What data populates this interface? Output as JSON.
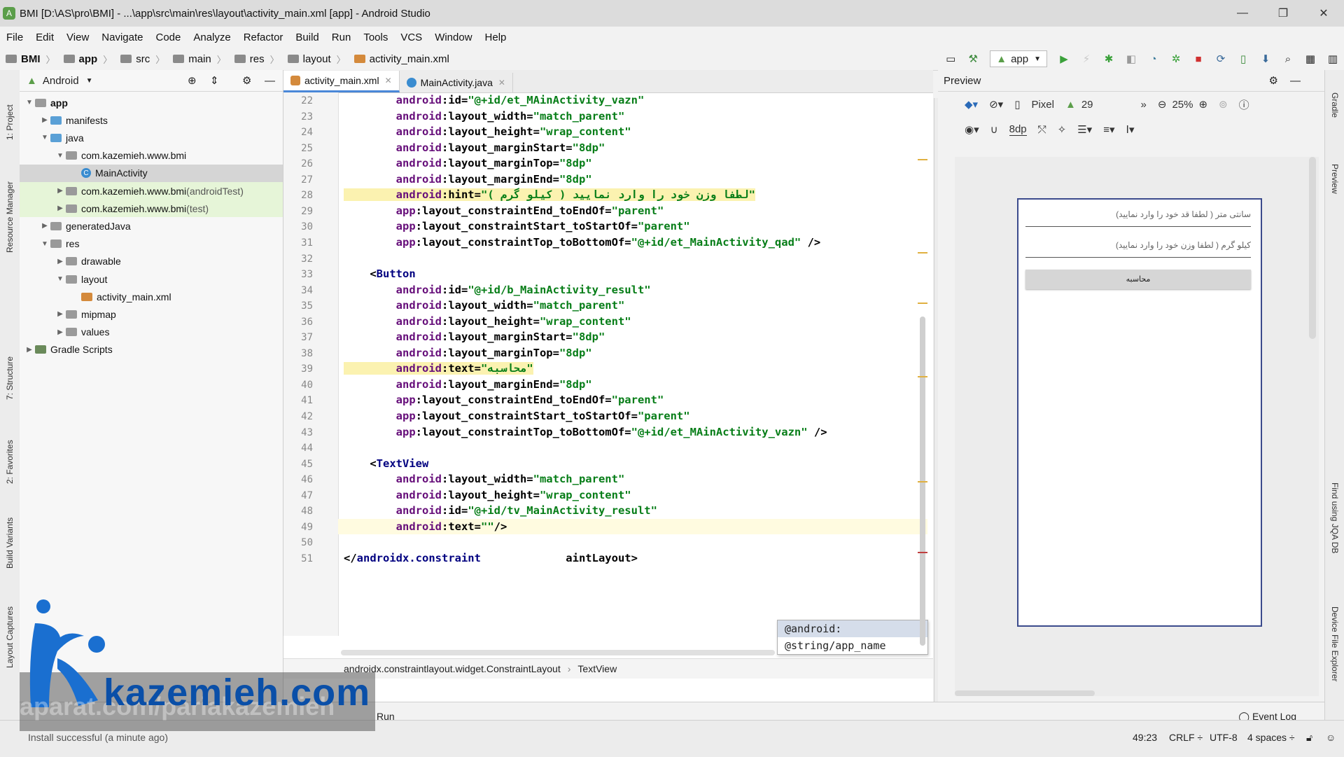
{
  "window": {
    "title": "BMI [D:\\AS\\pro\\BMI] - ...\\app\\src\\main\\res\\layout\\activity_main.xml [app] - Android Studio",
    "minimize": "—",
    "restore": "❐",
    "close": "✕"
  },
  "menu": [
    "File",
    "Edit",
    "View",
    "Navigate",
    "Code",
    "Analyze",
    "Refactor",
    "Build",
    "Run",
    "Tools",
    "VCS",
    "Window",
    "Help"
  ],
  "breadcrumb": [
    "BMI",
    "app",
    "src",
    "main",
    "res",
    "layout",
    "activity_main.xml"
  ],
  "toolbar": {
    "run_config": "app"
  },
  "left_tabs": [
    "1: Project",
    "Resource Manager",
    "7: Structure",
    "2: Favorites",
    "Build Variants",
    "Layout Captures"
  ],
  "project": {
    "view": "Android",
    "tree": [
      {
        "label": "app",
        "depth": 0,
        "arrow": "▼",
        "icon": "folder",
        "bold": true
      },
      {
        "label": "manifests",
        "depth": 1,
        "arrow": "▶",
        "icon": "folder-blue"
      },
      {
        "label": "java",
        "depth": 1,
        "arrow": "▼",
        "icon": "folder-blue"
      },
      {
        "label": "com.kazemieh.www.bmi",
        "depth": 2,
        "arrow": "▼",
        "icon": "folder"
      },
      {
        "label": "MainActivity",
        "depth": 3,
        "arrow": "",
        "icon": "class",
        "selected": true
      },
      {
        "label": "com.kazemieh.www.bmi",
        "suffix": " (androidTest)",
        "depth": 2,
        "arrow": "▶",
        "icon": "folder",
        "hl": true
      },
      {
        "label": "com.kazemieh.www.bmi",
        "suffix": " (test)",
        "depth": 2,
        "arrow": "▶",
        "icon": "folder",
        "hl": true
      },
      {
        "label": "generatedJava",
        "depth": 1,
        "arrow": "▶",
        "icon": "folder"
      },
      {
        "label": "res",
        "depth": 1,
        "arrow": "▼",
        "icon": "folder"
      },
      {
        "label": "drawable",
        "depth": 2,
        "arrow": "▶",
        "icon": "folder"
      },
      {
        "label": "layout",
        "depth": 2,
        "arrow": "▼",
        "icon": "folder"
      },
      {
        "label": "activity_main.xml",
        "depth": 3,
        "arrow": "",
        "icon": "xml"
      },
      {
        "label": "mipmap",
        "depth": 2,
        "arrow": "▶",
        "icon": "folder"
      },
      {
        "label": "values",
        "depth": 2,
        "arrow": "▶",
        "icon": "folder"
      },
      {
        "label": "Gradle Scripts",
        "depth": 0,
        "arrow": "▶",
        "icon": "gradle"
      }
    ]
  },
  "editor": {
    "tabs": [
      {
        "label": "activity_main.xml",
        "active": true
      },
      {
        "label": "MainActivity.java",
        "active": false
      }
    ],
    "lines": [
      {
        "n": "22",
        "text": "        android:id=\"@+id/et_MAinActivity_vazn\""
      },
      {
        "n": "23",
        "text": "        android:layout_width=\"match_parent\""
      },
      {
        "n": "24",
        "text": "        android:layout_height=\"wrap_content\""
      },
      {
        "n": "25",
        "text": "        android:layout_marginStart=\"8dp\""
      },
      {
        "n": "26",
        "text": "        android:layout_marginTop=\"8dp\""
      },
      {
        "n": "27",
        "text": "        android:layout_marginEnd=\"8dp\""
      },
      {
        "n": "28",
        "text": "        android:hint=\"( لطفا وزن خود را وارد نمایید ( کیلو گرم\"",
        "hl": true
      },
      {
        "n": "29",
        "text": "        app:layout_constraintEnd_toEndOf=\"parent\""
      },
      {
        "n": "30",
        "text": "        app:layout_constraintStart_toStartOf=\"parent\""
      },
      {
        "n": "31",
        "text": "        app:layout_constraintTop_toBottomOf=\"@+id/et_MainActivity_qad\" />"
      },
      {
        "n": "32",
        "text": ""
      },
      {
        "n": "33",
        "text": "    <Button"
      },
      {
        "n": "34",
        "text": "        android:id=\"@+id/b_MainActivity_result\""
      },
      {
        "n": "35",
        "text": "        android:layout_width=\"match_parent\""
      },
      {
        "n": "36",
        "text": "        android:layout_height=\"wrap_content\""
      },
      {
        "n": "37",
        "text": "        android:layout_marginStart=\"8dp\""
      },
      {
        "n": "38",
        "text": "        android:layout_marginTop=\"8dp\""
      },
      {
        "n": "39",
        "text": "        android:text=\"محاسبه\"",
        "hl": true
      },
      {
        "n": "40",
        "text": "        android:layout_marginEnd=\"8dp\""
      },
      {
        "n": "41",
        "text": "        app:layout_constraintEnd_toEndOf=\"parent\""
      },
      {
        "n": "42",
        "text": "        app:layout_constraintStart_toStartOf=\"parent\""
      },
      {
        "n": "43",
        "text": "        app:layout_constraintTop_toBottomOf=\"@+id/et_MAinActivity_vazn\" />"
      },
      {
        "n": "44",
        "text": ""
      },
      {
        "n": "45",
        "text": "    <TextView"
      },
      {
        "n": "46",
        "text": "        android:layout_width=\"match_parent\""
      },
      {
        "n": "47",
        "text": "        android:layout_height=\"wrap_content\""
      },
      {
        "n": "48",
        "text": "        android:id=\"@+id/tv_MainActivity_result\""
      },
      {
        "n": "49",
        "text": "        android:text=\"\"/>",
        "current": true
      },
      {
        "n": "50",
        "text": ""
      },
      {
        "n": "51",
        "text": "</androidx.constraint             aintLayout>"
      }
    ],
    "autocomplete": [
      "@android:",
      "@string/app_name"
    ],
    "path": [
      "androidx.constraintlayout.widget.ConstraintLayout",
      "TextView"
    ]
  },
  "preview": {
    "title": "Preview",
    "device": "Pixel",
    "api": "29",
    "zoom": "25%",
    "margin": "8dp",
    "hint_height": "سانتی متر ( لطفا قد خود را وارد نمایید)",
    "hint_weight": "کیلو گرم ( لطفا وزن خود را وارد نمایید)",
    "button": "محاسبه"
  },
  "right_tabs": [
    "Gradle",
    "Preview",
    "Find using JQA DB",
    "Device File Explorer"
  ],
  "bottom": {
    "run_label": "Run",
    "event_log": "Event Log"
  },
  "status": {
    "message": "Install successful (a minute ago)",
    "position": "49:23",
    "line_sep": "CRLF ÷",
    "encoding": "UTF-8",
    "indent": "4 spaces ÷"
  },
  "watermark": {
    "brand": "kazemieh.com",
    "sub": "aparat.com/pariakazemieh"
  }
}
